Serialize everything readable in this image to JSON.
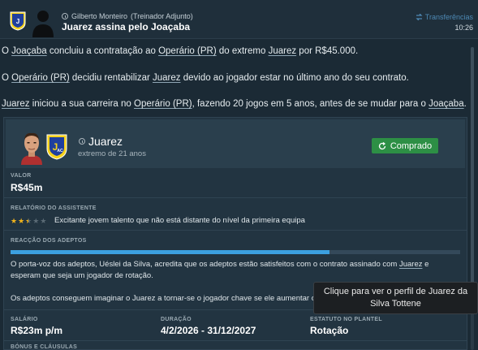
{
  "header": {
    "sender_name": "Gilberto Monteiro",
    "sender_role": "(Treinador Adjunto)",
    "headline": "Juarez assina pelo Joaçaba",
    "category": "Transferências",
    "time": "10:26"
  },
  "body": {
    "p1": [
      {
        "t": "O "
      },
      {
        "t": "Joaçaba",
        "u": true
      },
      {
        "t": " concluiu a contratação ao "
      },
      {
        "t": "Operário (PR)",
        "u": true
      },
      {
        "t": " do extremo "
      },
      {
        "t": "Juarez",
        "u": true
      },
      {
        "t": " por R$45.000."
      }
    ],
    "p2": [
      {
        "t": "O "
      },
      {
        "t": "Operário (PR)",
        "u": true
      },
      {
        "t": " decidiu rentabilizar "
      },
      {
        "t": "Juarez",
        "u": true
      },
      {
        "t": " devido ao jogador estar no último ano do seu contrato."
      }
    ],
    "p3": [
      {
        "t": "Juarez",
        "u": true
      },
      {
        "t": " iniciou a sua carreira no "
      },
      {
        "t": "Operário (PR)",
        "u": true
      },
      {
        "t": ", fazendo 20 jogos em 5 anos, antes de se mudar para o "
      },
      {
        "t": "Joaçaba",
        "u": true
      },
      {
        "t": "."
      }
    ]
  },
  "card": {
    "player_name": "Juarez",
    "player_sub": "extremo de 21 anos",
    "status_label": "Comprado",
    "value_label": "VALOR",
    "value": "R$45m",
    "report_label": "RELATÓRIO DO ASSISTENTE",
    "rating_stars": 2.5,
    "report_text": "Excitante jovem talento que não está distante do nível da primeira equipa",
    "fan_label": "REACÇÃO DOS ADEPTOS",
    "fan_reaction_fraction": 0.71,
    "fan_para1": [
      {
        "t": "O porta-voz dos adeptos, Uéslei da Silva, acredita que os adeptos estão satisfeitos com o contrato assinado com "
      },
      {
        "t": "Juarez",
        "u": true
      },
      {
        "t": "  e esperam que seja um jogador de rotação."
      }
    ],
    "fan_para2": "Os adeptos conseguem imaginar o Juarez a tornar-se o jogador chave se ele aumentar o seu",
    "salary_label": "SALÁRIO",
    "salary": "R$23m p/m",
    "duration_label": "DURAÇÃO",
    "duration": "4/2/2026 - 31/12/2027",
    "squad_status_label": "ESTATUTO NO PLANTEL",
    "squad_status": "Rotação",
    "bonus_label": "BÓNUS E CLÁUSULAS"
  },
  "tooltip": {
    "text": "Clique para ver o perfil de Juarez da Silva Tottene"
  },
  "colors": {
    "background": "#1b2a35",
    "card": "#223441",
    "status_green": "#2d8f45",
    "fan_bar": "#3ca0e0",
    "star_gold": "#f2b41b",
    "badge_yellow": "#f7d21b",
    "badge_blue": "#1f3f9e"
  }
}
